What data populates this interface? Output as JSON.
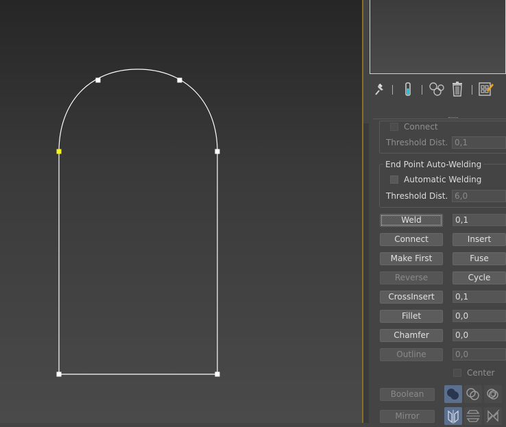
{
  "toolbar": {
    "icons": [
      "pin-stack-icon",
      "show-end-result-icon",
      "make-unique-icon",
      "remove-modifier-icon",
      "configure-modifier-sets-icon"
    ]
  },
  "connect_group": {
    "connect_label": "Connect",
    "threshold_label": "Threshold Dist.",
    "threshold_value": "0,1"
  },
  "endpoint_group": {
    "title": "End Point Auto-Welding",
    "auto_weld_label": "Automatic Welding",
    "threshold_label": "Threshold Dist.",
    "threshold_value": "6,0"
  },
  "geometry": {
    "weld_label": "Weld",
    "weld_value": "0,1",
    "connect_label": "Connect",
    "insert_label": "Insert",
    "make_first_label": "Make First",
    "fuse_label": "Fuse",
    "reverse_label": "Reverse",
    "cycle_label": "Cycle",
    "crossinsert_label": "CrossInsert",
    "crossinsert_value": "0,1",
    "fillet_label": "Fillet",
    "fillet_value": "0,0",
    "chamfer_label": "Chamfer",
    "chamfer_value": "0,0",
    "outline_label": "Outline",
    "outline_value": "0,0",
    "center_label": "Center",
    "boolean_label": "Boolean",
    "mirror_label": "Mirror"
  },
  "colors": {
    "selected_vertex": "#f5f51e",
    "vertex": "#ffffff",
    "spline": "#ffffff",
    "panel_divider": "#8a6f2a",
    "selected_icon_bg": "#5b6f8f"
  }
}
